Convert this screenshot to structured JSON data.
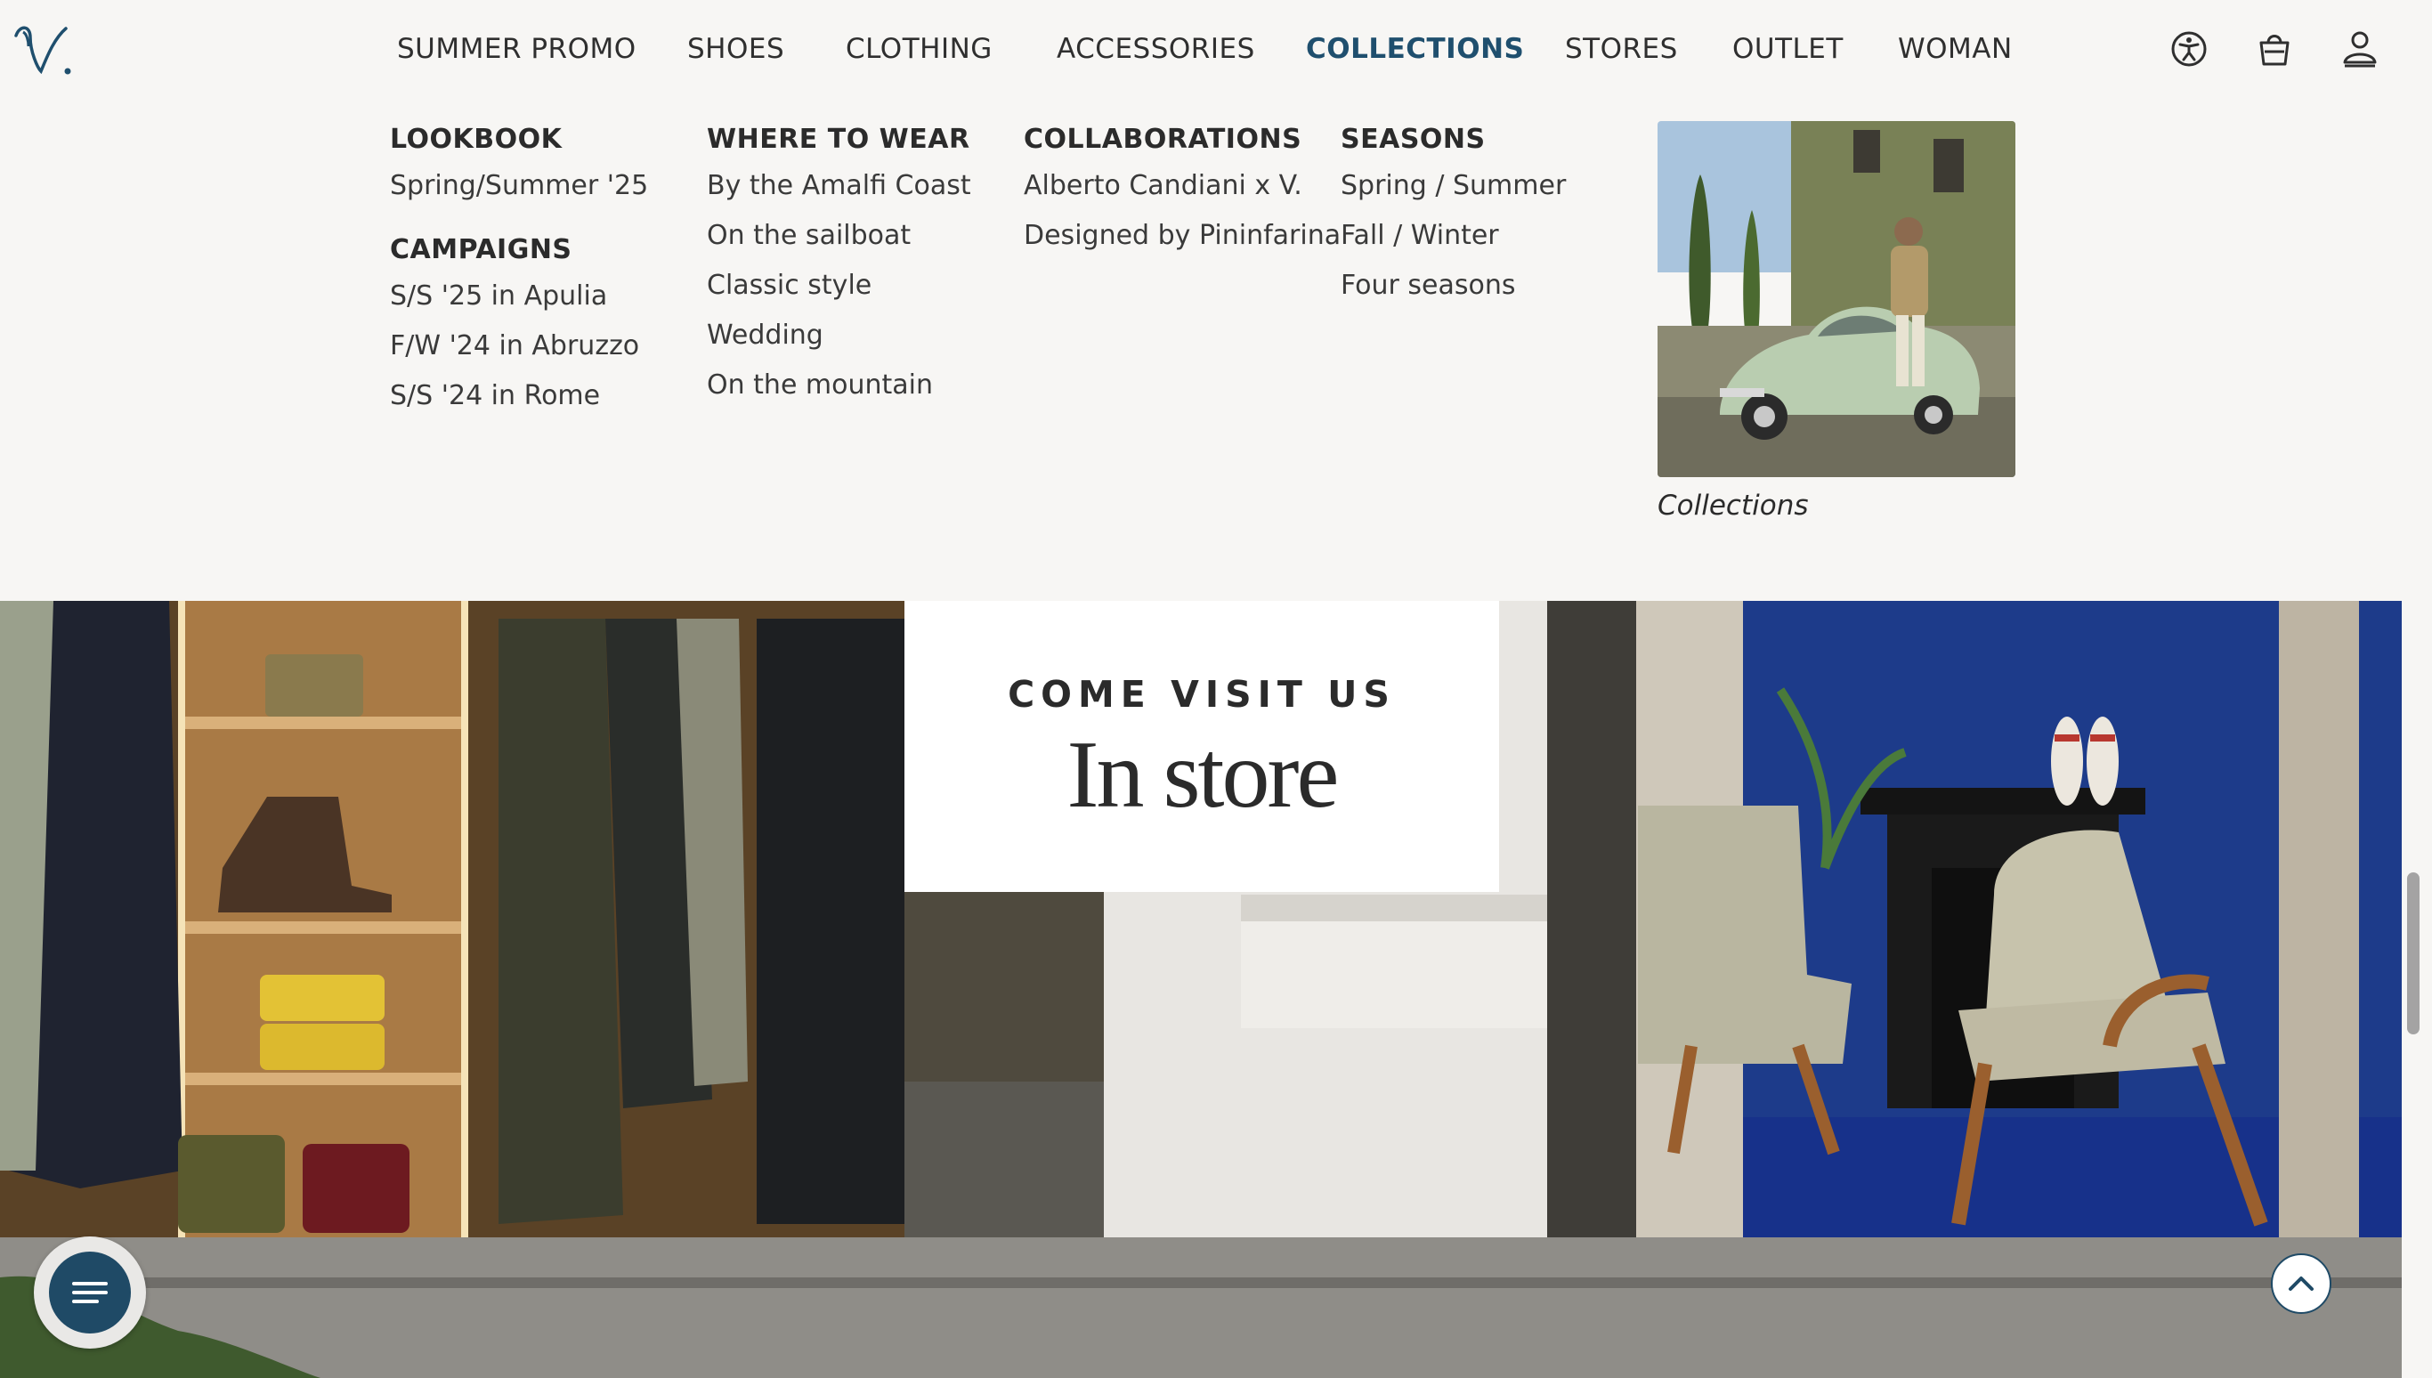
{
  "brand": {
    "logo_text": "V."
  },
  "nav": {
    "items": [
      {
        "label": "SUMMER PROMO"
      },
      {
        "label": "SHOES"
      },
      {
        "label": "CLOTHING"
      },
      {
        "label": "ACCESSORIES"
      },
      {
        "label": "COLLECTIONS",
        "active": true
      },
      {
        "label": "STORES"
      },
      {
        "label": "OUTLET"
      },
      {
        "label": "WOMAN"
      }
    ],
    "icons": [
      "accessibility-icon",
      "shopping-bag-icon",
      "account-icon"
    ]
  },
  "mega_menu": {
    "lookbook": {
      "heading": "LOOKBOOK",
      "links": [
        "Spring/Summer '25"
      ]
    },
    "campaigns": {
      "heading": "CAMPAIGNS",
      "links": [
        "S/S '25 in Apulia",
        "F/W '24 in Abruzzo",
        "S/S '24 in Rome"
      ]
    },
    "where_to_wear": {
      "heading": "WHERE TO WEAR",
      "links": [
        "By the Amalfi Coast",
        "On the sailboat",
        "Classic style",
        "Wedding",
        "On the mountain"
      ]
    },
    "collaborations": {
      "heading": "COLLABORATIONS",
      "links": [
        "Alberto Candiani x V.",
        "Designed by Pininfarina"
      ]
    },
    "seasons": {
      "heading": "SEASONS",
      "links": [
        "Spring / Summer",
        "Fall / Winter",
        "Four seasons"
      ]
    },
    "feature": {
      "caption": "Collections"
    }
  },
  "store_banner": {
    "kicker": "COME VISIT US",
    "title": "In store"
  },
  "colors": {
    "accent": "#1f4f6e",
    "background": "#f7f6f4",
    "text": "#2f2f2f"
  }
}
